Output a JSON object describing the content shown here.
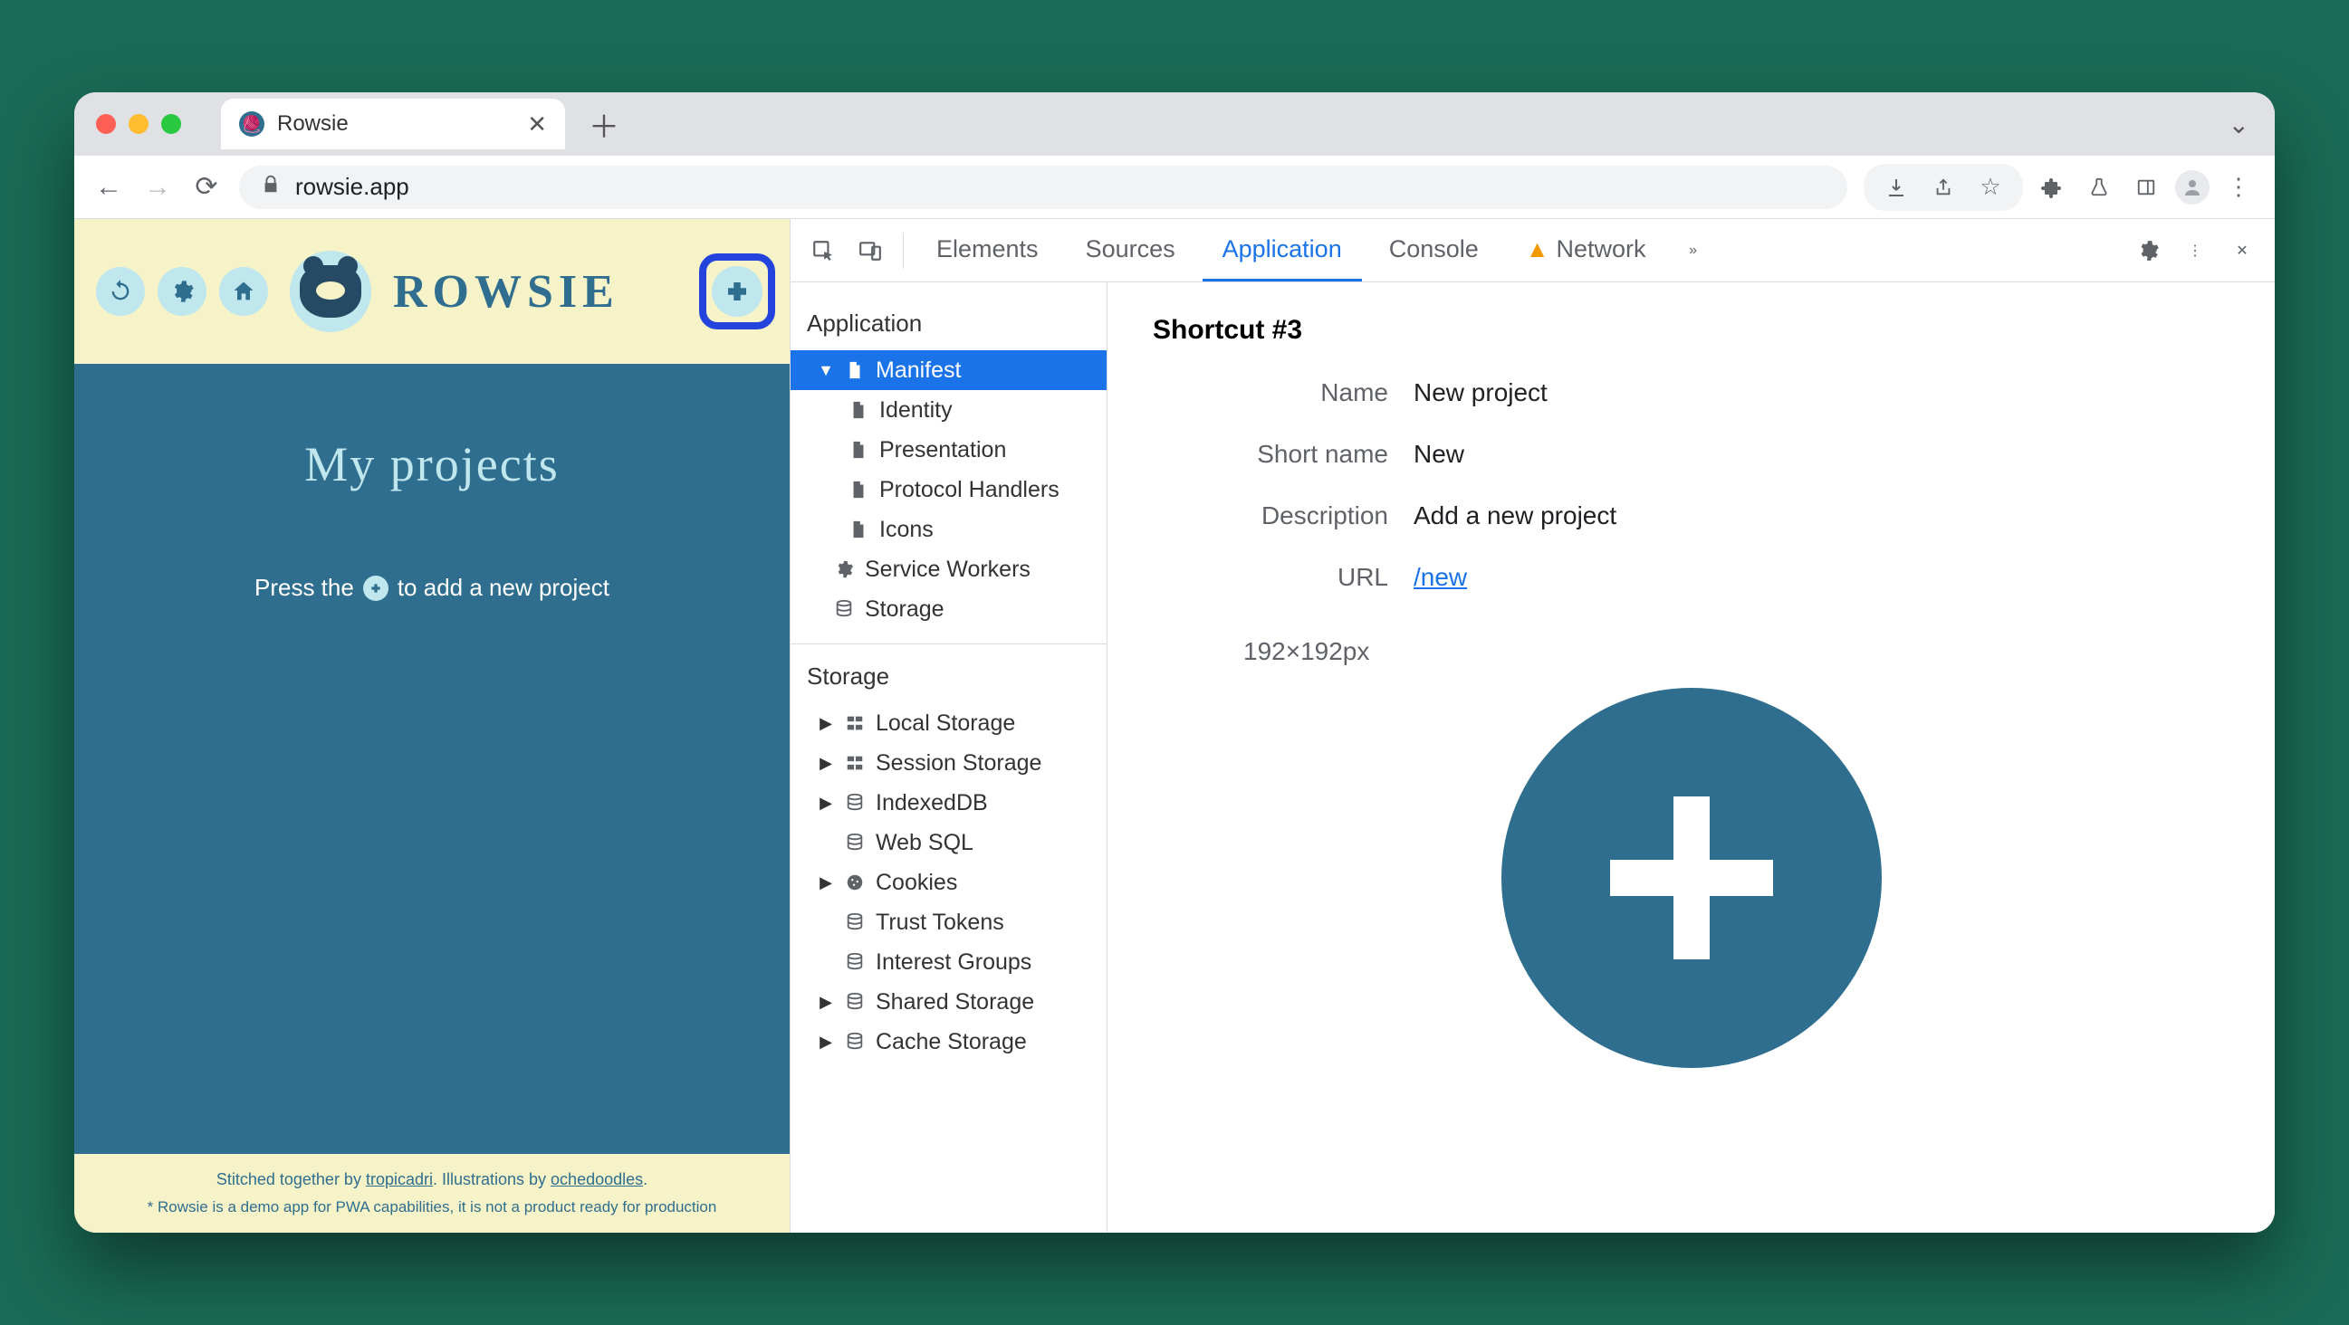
{
  "browser": {
    "tab_title": "Rowsie",
    "url": "rowsie.app"
  },
  "app": {
    "logo_text": "ROWSIE",
    "page_title": "My projects",
    "hint_before": "Press the",
    "hint_after": "to add a new project",
    "footer_line1_a": "Stitched together by ",
    "footer_link1": "tropicadri",
    "footer_line1_b": ". Illustrations by ",
    "footer_link2": "ochedoodles",
    "footer_line1_c": ".",
    "footer_line2": "* Rowsie is a demo app for PWA capabilities, it is not a product ready for production"
  },
  "devtools": {
    "tabs": [
      "Elements",
      "Sources",
      "Application",
      "Console",
      "Network"
    ],
    "active_tab": "Application",
    "network_has_warning": true,
    "side": {
      "section1": "Application",
      "manifest": "Manifest",
      "manifest_children": [
        "Identity",
        "Presentation",
        "Protocol Handlers",
        "Icons"
      ],
      "service_workers": "Service Workers",
      "storage_item": "Storage",
      "section2": "Storage",
      "storage_children": [
        "Local Storage",
        "Session Storage",
        "IndexedDB",
        "Web SQL",
        "Cookies",
        "Trust Tokens",
        "Interest Groups",
        "Shared Storage",
        "Cache Storage"
      ],
      "storage_expandable": [
        true,
        true,
        true,
        false,
        true,
        false,
        false,
        true,
        true
      ]
    },
    "detail": {
      "title": "Shortcut #3",
      "rows": {
        "name_label": "Name",
        "name_value": "New project",
        "short_label": "Short name",
        "short_value": "New",
        "desc_label": "Description",
        "desc_value": "Add a new project",
        "url_label": "URL",
        "url_value": "/new"
      },
      "icon_dim": "192×192px"
    }
  }
}
